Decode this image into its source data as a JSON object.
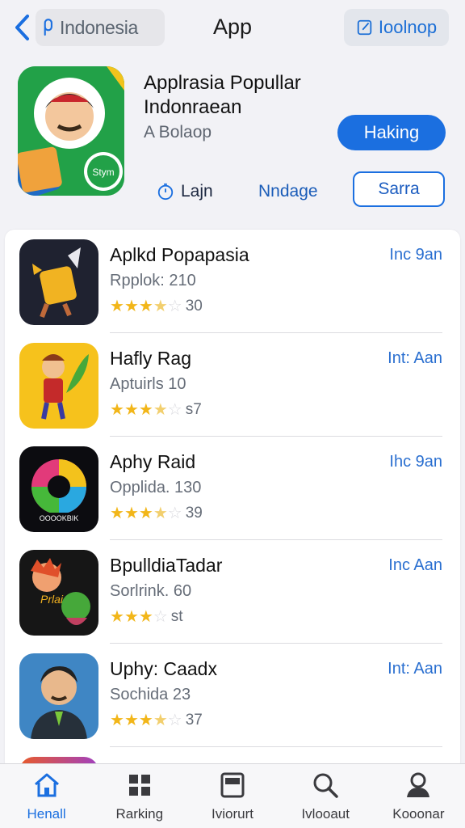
{
  "header": {
    "region_label": "Indonesia",
    "title": "App",
    "right_button_label": "Ioolnop"
  },
  "featured": {
    "title_line1": "Applrasia Popullar",
    "title_line2": "Indonraean",
    "subtitle": "A Bolaop",
    "get_label": "Haking",
    "link1_label": "Lajn",
    "link2_label": "Nndage",
    "outline_label": "Sarra"
  },
  "apps": [
    {
      "name": "Aplkd Popapasia",
      "meta": "Rpplok: 210",
      "rating": 3.5,
      "count": "30",
      "action": "Inc 9an"
    },
    {
      "name": "Hafly Rag",
      "meta": "Aptuirls 10",
      "rating": 3.5,
      "count": "s7",
      "action": "Int: Aan"
    },
    {
      "name": "Aphy Raid",
      "meta": "Opplida. 130",
      "rating": 3.5,
      "count": "39",
      "action": "Ihc 9an"
    },
    {
      "name": "BpulldiaTadar",
      "meta": "Sorlrink. 60",
      "rating": 3.5,
      "count": "st",
      "action": "Inc Aan"
    },
    {
      "name": "Uphy: Caadx",
      "meta": "Sochida 23",
      "rating": 3.5,
      "count": "37",
      "action": "Int: Aan"
    }
  ],
  "tabs": [
    {
      "label": "Henall",
      "icon": "home-icon",
      "active": true
    },
    {
      "label": "Rarking",
      "icon": "grid-icon",
      "active": false
    },
    {
      "label": "Iviorurt",
      "icon": "square-icon",
      "active": false
    },
    {
      "label": "Ivlooaut",
      "icon": "search-icon",
      "active": false
    },
    {
      "label": "Kooonar",
      "icon": "person-icon",
      "active": false
    }
  ],
  "colors": {
    "accent": "#1b6fe0",
    "star": "#f2b619",
    "background": "#f2f2f6"
  }
}
